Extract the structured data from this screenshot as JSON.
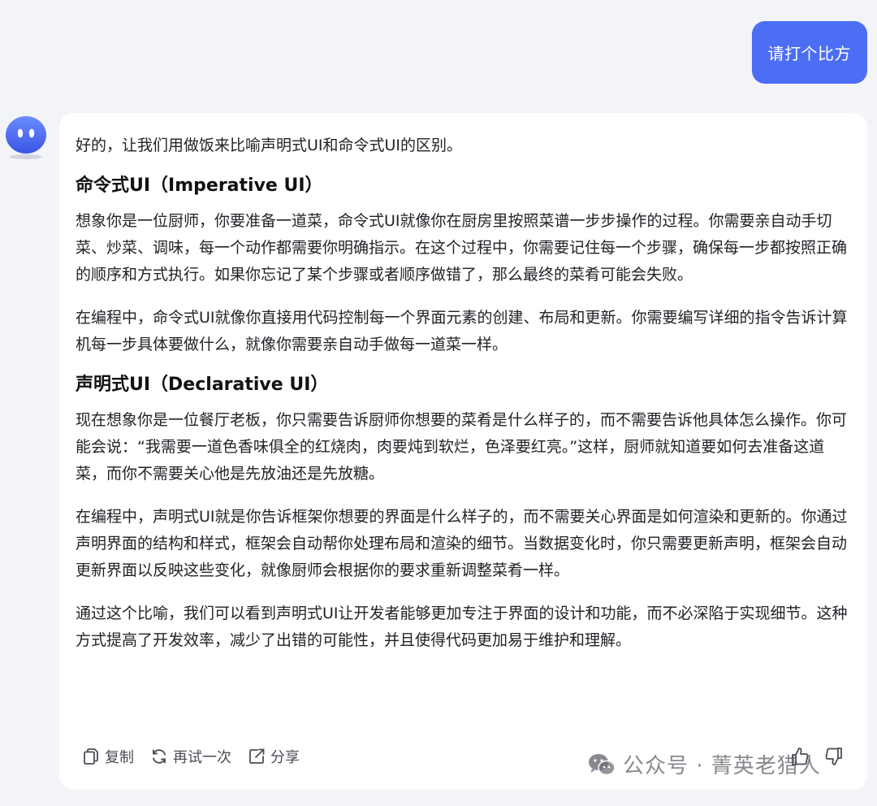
{
  "user_message": "请打个比方",
  "answer": {
    "intro": "好的，让我们用做饭来比喻声明式UI和命令式UI的区别。",
    "imperative_heading": "命令式UI（Imperative UI）",
    "imperative_p1": "想象你是一位厨师，你要准备一道菜，命令式UI就像你在厨房里按照菜谱一步步操作的过程。你需要亲自动手切菜、炒菜、调味，每一个动作都需要你明确指示。在这个过程中，你需要记住每一个步骤，确保每一步都按照正确的顺序和方式执行。如果你忘记了某个步骤或者顺序做错了，那么最终的菜肴可能会失败。",
    "imperative_p2": "在编程中，命令式UI就像你直接用代码控制每一个界面元素的创建、布局和更新。你需要编写详细的指令告诉计算机每一步具体要做什么，就像你需要亲自动手做每一道菜一样。",
    "declarative_heading": "声明式UI（Declarative UI）",
    "declarative_p1": "现在想象你是一位餐厅老板，你只需要告诉厨师你想要的菜肴是什么样子的，而不需要告诉他具体怎么操作。你可能会说：“我需要一道色香味俱全的红烧肉，肉要炖到软烂，色泽要红亮。”这样，厨师就知道要如何去准备这道菜，而你不需要关心他是先放油还是先放糖。",
    "declarative_p2": "在编程中，声明式UI就是你告诉框架你想要的界面是什么样子的，而不需要关心界面是如何渲染和更新的。你通过声明界面的结构和样式，框架会自动帮你处理布局和渲染的细节。当数据变化时，你只需要更新声明，框架会自动更新界面以反映这些变化，就像厨师会根据你的要求重新调整菜肴一样。",
    "conclusion": "通过这个比喻，我们可以看到声明式UI让开发者能够更加专注于界面的设计和功能，而不必深陷于实现细节。这种方式提高了开发效率，减少了出错的可能性，并且使得代码更加易于维护和理解。"
  },
  "actions": {
    "copy_label": "复制",
    "retry_label": "再试一次",
    "share_label": "分享"
  },
  "watermark": "公众号 · 菁英老猎人",
  "colors": {
    "user_bubble": "#4c6ef5",
    "background": "#f3f4f8",
    "card": "#ffffff"
  },
  "icons": [
    "copy-icon",
    "retry-icon",
    "share-icon",
    "thumbs-up-icon",
    "thumbs-down-icon",
    "wechat-icon",
    "bot-avatar"
  ]
}
